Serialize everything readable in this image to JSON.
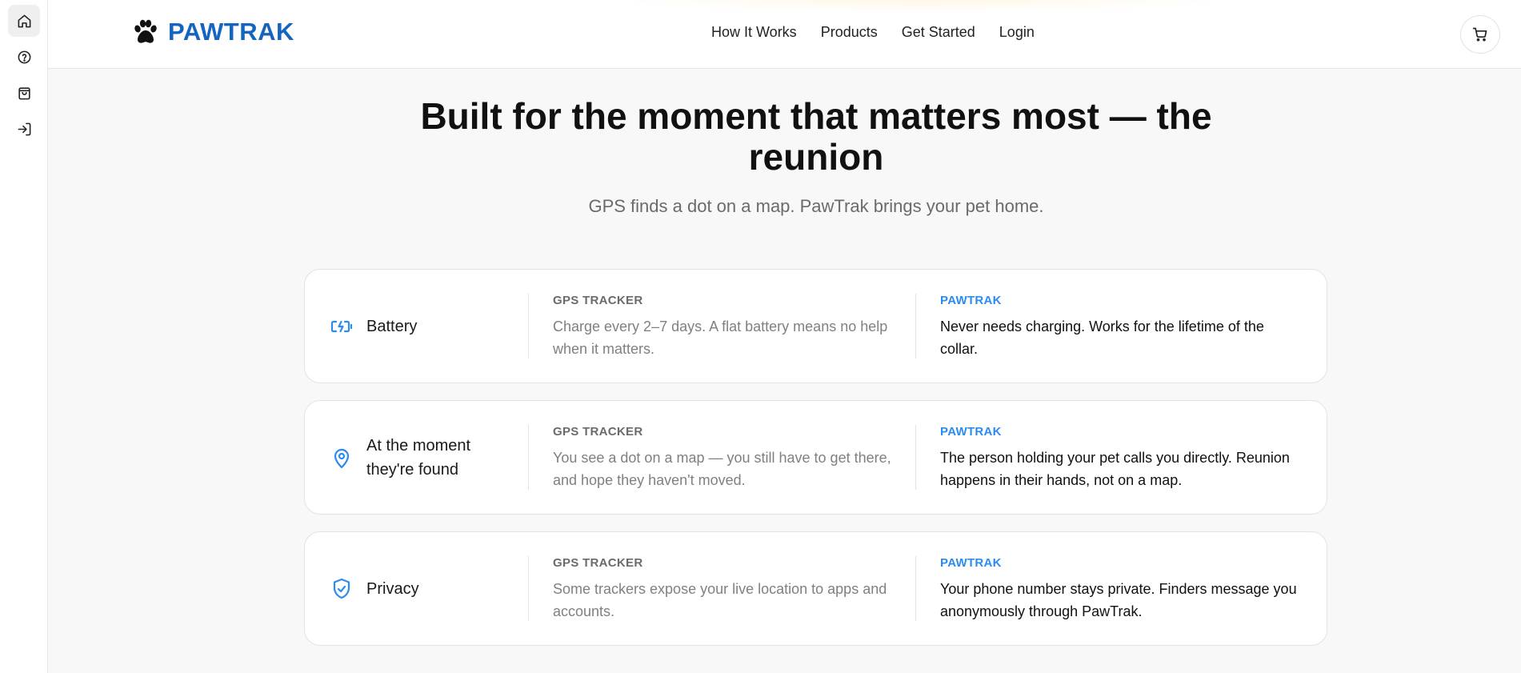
{
  "sidebar": {
    "items": [
      {
        "name": "home",
        "icon": "home-icon"
      },
      {
        "name": "help",
        "icon": "help-circle-icon"
      },
      {
        "name": "shop",
        "icon": "shopping-bag-icon"
      },
      {
        "name": "login",
        "icon": "log-in-icon"
      }
    ]
  },
  "header": {
    "brand": "PAWTRAK",
    "brand_color": "#1565c0",
    "logo_icon": "paw-print-icon",
    "nav": [
      "How It Works",
      "Products",
      "Get Started",
      "Login"
    ],
    "cart_icon": "shopping-cart-icon"
  },
  "hero": {
    "title": "Built for the moment that matters most — the reunion",
    "subtitle": "GPS finds a dot on a map. PawTrak brings your pet home."
  },
  "comparison": {
    "accent_color": "#2a8bf0",
    "rows": [
      {
        "feature": "Battery",
        "icon": "battery-charging-icon",
        "gps_label": "GPS TRACKER",
        "gps_text": "Charge every 2–7 days. A flat battery means no help when it matters.",
        "pawtrak_label": "PAWTRAK",
        "pawtrak_text": "Never needs charging. Works for the lifetime of the collar."
      },
      {
        "feature": "At the moment they're found",
        "icon": "map-pin-icon",
        "gps_label": "GPS TRACKER",
        "gps_text": "You see a dot on a map — you still have to get there, and hope they haven't moved.",
        "pawtrak_label": "PAWTRAK",
        "pawtrak_text": "The person holding your pet calls you directly. Reunion happens in their hands, not on a map."
      },
      {
        "feature": "Privacy",
        "icon": "shield-check-icon",
        "gps_label": "GPS TRACKER",
        "gps_text": "Some trackers expose your live location to apps and accounts.",
        "pawtrak_label": "PAWTRAK",
        "pawtrak_text": "Your phone number stays private. Finders message you anonymously through PawTrak."
      }
    ]
  }
}
